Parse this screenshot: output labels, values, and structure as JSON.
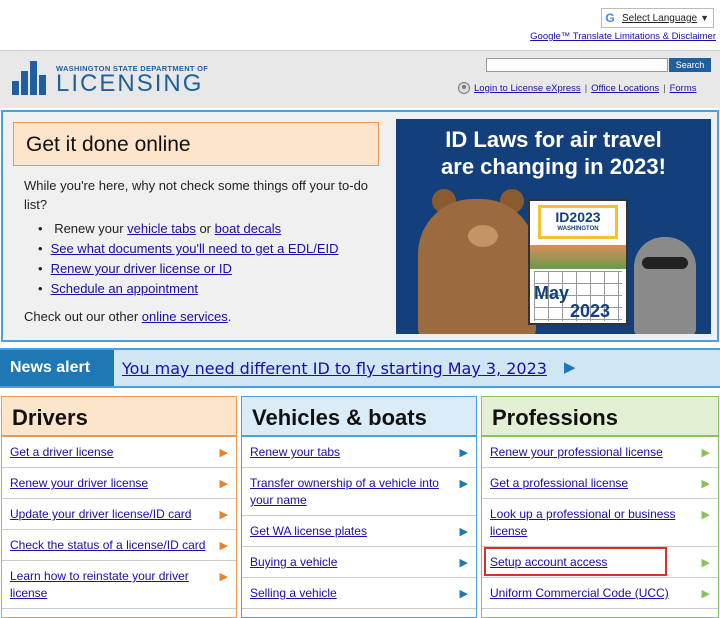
{
  "translate": {
    "select_language": "Select Language",
    "limitations_link": "Google™ Translate Limitations & Disclaimer"
  },
  "header": {
    "logo_small": "WASHINGTON STATE DEPARTMENT OF",
    "logo_big": "LICENSING",
    "search_placeholder": "",
    "search_button": "Search",
    "login_link": "Login to License eXpress",
    "office_link": "Office Locations",
    "forms_link": "Forms"
  },
  "done": {
    "title": "Get it done online",
    "intro": "While you're here, why not check some things off your to-do list?",
    "items": [
      {
        "pre": "Renew your ",
        "link1": "vehicle tabs",
        "mid": " or ",
        "link2": "boat decals"
      },
      {
        "link": "See what documents you'll need to get a EDL/EID"
      },
      {
        "link": "Renew your driver license or ID"
      },
      {
        "link": "Schedule an appointment"
      }
    ],
    "other_pre": "Check out our other ",
    "other_link": "online services",
    "other_post": "."
  },
  "banner": {
    "line1": "ID Laws for air travel",
    "line2": "are changing in 2023!",
    "cal_id": "ID2023",
    "cal_state": "WASHINGTON",
    "cal_month": "May",
    "cal_year": "2023"
  },
  "news": {
    "label": "News alert",
    "link": "You may need different ID to fly starting May 3, 2023",
    "arrow": "▶"
  },
  "columns": {
    "drivers": {
      "title": "Drivers",
      "items": [
        "Get a driver license",
        "Renew your driver license",
        "Update your driver license/ID card",
        "Check the status of a license/ID card",
        "Learn how to reinstate your driver license"
      ]
    },
    "vehicles": {
      "title": "Vehicles & boats",
      "items": [
        "Renew your tabs",
        "Transfer ownership of a vehicle into your name",
        "Get WA license plates",
        "Buying a vehicle",
        "Selling a vehicle"
      ]
    },
    "professions": {
      "title": "Professions",
      "items": [
        "Renew your professional license",
        "Get a professional license",
        "Look up a professional or business license",
        "Setup account access",
        "Uniform Commercial Code (UCC)"
      ]
    }
  },
  "colors": {
    "brand_blue": "#1f5f9e",
    "accent_orange": "#e89a55",
    "accent_blue": "#4aa0d8",
    "accent_green": "#8cc05a",
    "highlight_red": "#d9302c"
  }
}
